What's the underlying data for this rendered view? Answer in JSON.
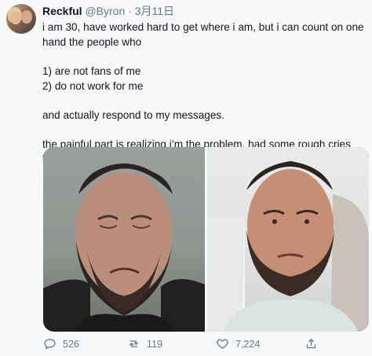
{
  "user": {
    "display_name": "Reckful",
    "handle": "@Byron",
    "separator": " · ",
    "date": "3月11日"
  },
  "tweet": {
    "lines": [
      "i am 30, have worked hard to get where i am, but i can count on one hand the people who",
      "1) are not fans of me",
      "2) do not work for me",
      "and actually respond to my messages.",
      "the painful part is realizing i’m the problem. had some rough cries but i will keep trying to improve..."
    ]
  },
  "actions": {
    "replies": "526",
    "retweets": "119",
    "likes": "7,224"
  },
  "icons": {
    "reply": "reply-icon",
    "retweet": "retweet-icon",
    "like": "heart-icon",
    "share": "share-icon"
  },
  "colors": {
    "text": "#14171a",
    "muted": "#657786",
    "background": "#f7f9fa"
  }
}
